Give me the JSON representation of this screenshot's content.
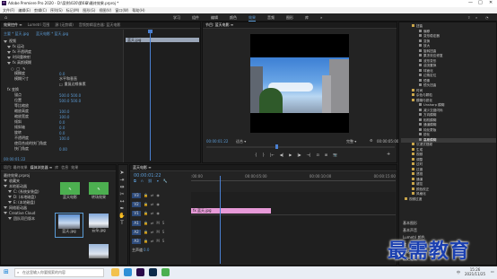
{
  "app": {
    "title": "Adobe Premiere Pro 2020 - D:\\案例\\020\\第6章\\最终效果.prproj *",
    "window_controls": [
      "—",
      "□",
      "✕"
    ]
  },
  "menu": [
    "文件(F)",
    "编辑(E)",
    "剪辑(C)",
    "序列(S)",
    "标记(M)",
    "图形(G)",
    "视图(V)",
    "窗口(W)",
    "帮助(H)"
  ],
  "workspaces": {
    "items": [
      "学习",
      "组件",
      "编辑",
      "颜色",
      "效果",
      "音频",
      "图形",
      "库"
    ],
    "active": "效果",
    "more": "»"
  },
  "effect_controls": {
    "tabs": [
      "效果控件 ≡",
      "Lumetri 范围",
      "源:(无剪辑)",
      "音频剪辑混合器: 蓝天电影"
    ],
    "source_label": "主要 * 蓝天.jpg",
    "sequence_label": "蓝天电影 * 蓝天.jpg",
    "clip_name": "蓝天.jpg",
    "sections": [
      {
        "label": "视频",
        "indent": 0
      },
      {
        "label": "fx  运动",
        "indent": 1
      },
      {
        "label": "fx  不透明度",
        "indent": 1
      },
      {
        "label": "时间重映射",
        "indent": 1
      },
      {
        "label": "fx  高斯模糊",
        "indent": 1
      }
    ],
    "params": [
      {
        "label": "模糊度",
        "value": "0.0"
      },
      {
        "label": "模糊尺寸",
        "value": "水平和垂直"
      },
      {
        "label": "",
        "value": "重复边缘像素"
      }
    ],
    "advanced": [
      {
        "label": "fx  变换",
        "value": ""
      },
      {
        "label": "锚点",
        "value": "500.0  500.0"
      },
      {
        "label": "位置",
        "value": "500.0  500.0"
      },
      {
        "label": "等比缩放",
        "value": ""
      },
      {
        "label": "缩放高度",
        "value": "100.0"
      },
      {
        "label": "缩放宽度",
        "value": "100.0"
      },
      {
        "label": "倾斜",
        "value": "0.0"
      },
      {
        "label": "倾斜轴",
        "value": "0.0"
      },
      {
        "label": "旋转",
        "value": "0.0"
      },
      {
        "label": "不透明度",
        "value": "100.0"
      },
      {
        "label": "使用合成的快门角度",
        "value": ""
      },
      {
        "label": "快门角度",
        "value": "0.00"
      }
    ],
    "timecode": "00:00:01:22"
  },
  "program": {
    "tab": "节目: 蓝天电影 ≡",
    "timecode_left": "00:00:01:22",
    "fit": "适合",
    "quality": "完整",
    "timecode_right": "00:00:05:00",
    "transport": [
      "{",
      "}",
      "|←",
      "◀|",
      "▶",
      "|▶",
      "→|",
      "⊡",
      "⊞",
      "📷"
    ]
  },
  "project": {
    "tabs": [
      "项目: 最终效果",
      "媒体浏览器 ≡",
      "库",
      "信息",
      "效果"
    ],
    "path": "最终效果.prproj",
    "search_placeholder": "",
    "tree": [
      {
        "label": "收藏夹",
        "indent": 0
      },
      {
        "label": "本地驱动器",
        "indent": 0
      },
      {
        "label": "C: (系统安装盘)",
        "indent": 1
      },
      {
        "label": "D: (本地磁盘)",
        "indent": 1
      },
      {
        "label": "E: (本地磁盘)",
        "indent": 1
      },
      {
        "label": "网络驱动器",
        "indent": 0
      },
      {
        "label": "Creative Cloud",
        "indent": 0
      },
      {
        "label": "团队项目版本",
        "indent": 1
      }
    ],
    "thumbs": [
      {
        "label": "蓝天电影",
        "sub": "5:00",
        "kind": "green"
      },
      {
        "label": "转场效果",
        "sub": "",
        "kind": "green"
      },
      {
        "label": "蓝天.jpg",
        "sub": "",
        "kind": "photo"
      },
      {
        "label": "云朵.jpg",
        "sub": "",
        "kind": "photo2"
      }
    ]
  },
  "timeline": {
    "tab": "蓝天电影 ≡",
    "timecode": "00:00:01:22",
    "ruler": [
      ":00:00",
      "00:00:05:00",
      "00:00:10:00",
      "00:00:15:00"
    ],
    "tracks": [
      {
        "name": "V3",
        "kind": "video"
      },
      {
        "name": "V2",
        "kind": "video"
      },
      {
        "name": "V1",
        "kind": "video"
      },
      {
        "name": "A1",
        "kind": "audio"
      },
      {
        "name": "A2",
        "kind": "audio"
      },
      {
        "name": "A3",
        "kind": "audio"
      },
      {
        "name": "主声道",
        "value": "0.0",
        "kind": "master"
      }
    ],
    "clip_label": "fx 蓝天.jpg",
    "clip_color": "#e79ad8"
  },
  "effects_panel": {
    "items": [
      {
        "label": "扭曲",
        "indent": 1
      },
      {
        "label": "偏移",
        "indent": 2
      },
      {
        "label": "变形稳定器",
        "indent": 2
      },
      {
        "label": "变换",
        "indent": 2
      },
      {
        "label": "放大",
        "indent": 2
      },
      {
        "label": "旋转扭曲",
        "indent": 2
      },
      {
        "label": "果冻效应修复",
        "indent": 2
      },
      {
        "label": "波形变形",
        "indent": 2
      },
      {
        "label": "湍流置换",
        "indent": 2
      },
      {
        "label": "球面化",
        "indent": 2
      },
      {
        "label": "边角定位",
        "indent": 2
      },
      {
        "label": "镜像",
        "indent": 2
      },
      {
        "label": "镜头扭曲",
        "indent": 2
      },
      {
        "label": "时间",
        "indent": 1
      },
      {
        "label": "杂色与颗粒",
        "indent": 1
      },
      {
        "label": "模糊与锐化",
        "indent": 1
      },
      {
        "label": "Unsharp 模糊",
        "indent": 2
      },
      {
        "label": "减少交错闪烁",
        "indent": 2
      },
      {
        "label": "方向模糊",
        "indent": 2
      },
      {
        "label": "相机模糊",
        "indent": 2
      },
      {
        "label": "通道模糊",
        "indent": 2
      },
      {
        "label": "钝化蒙版",
        "indent": 2
      },
      {
        "label": "锐化",
        "indent": 2
      },
      {
        "label": "高斯模糊",
        "indent": 2,
        "selected": true
      },
      {
        "label": "沉浸式视频",
        "indent": 1
      },
      {
        "label": "生成",
        "indent": 1
      },
      {
        "label": "视频",
        "indent": 1
      },
      {
        "label": "调整",
        "indent": 1
      },
      {
        "label": "过时",
        "indent": 1
      },
      {
        "label": "过渡",
        "indent": 1
      },
      {
        "label": "透视",
        "indent": 1
      },
      {
        "label": "通道",
        "indent": 1
      },
      {
        "label": "键控",
        "indent": 1
      },
      {
        "label": "颜色校正",
        "indent": 1
      },
      {
        "label": "风格化",
        "indent": 1
      },
      {
        "label": "视频过渡",
        "indent": 0
      }
    ],
    "bottom_items": [
      "基本图形",
      "基本声音",
      "Lumetri 颜色",
      "库",
      "标记",
      "历史记录"
    ]
  },
  "watermark": "最需教育",
  "taskbar": {
    "search": "在这里输入你要搜索的内容",
    "time": "15:26",
    "date": "2021/11/25",
    "lang": "中",
    "apps": [
      {
        "name": "file-explorer",
        "color": "#f2c14e"
      },
      {
        "name": "edge",
        "color": "#2f8fd6"
      },
      {
        "name": "premiere",
        "color": "#2a0a4a"
      },
      {
        "name": "photoshop",
        "color": "#0b2a4a"
      },
      {
        "name": "wechat",
        "color": "#4caf50"
      }
    ]
  }
}
